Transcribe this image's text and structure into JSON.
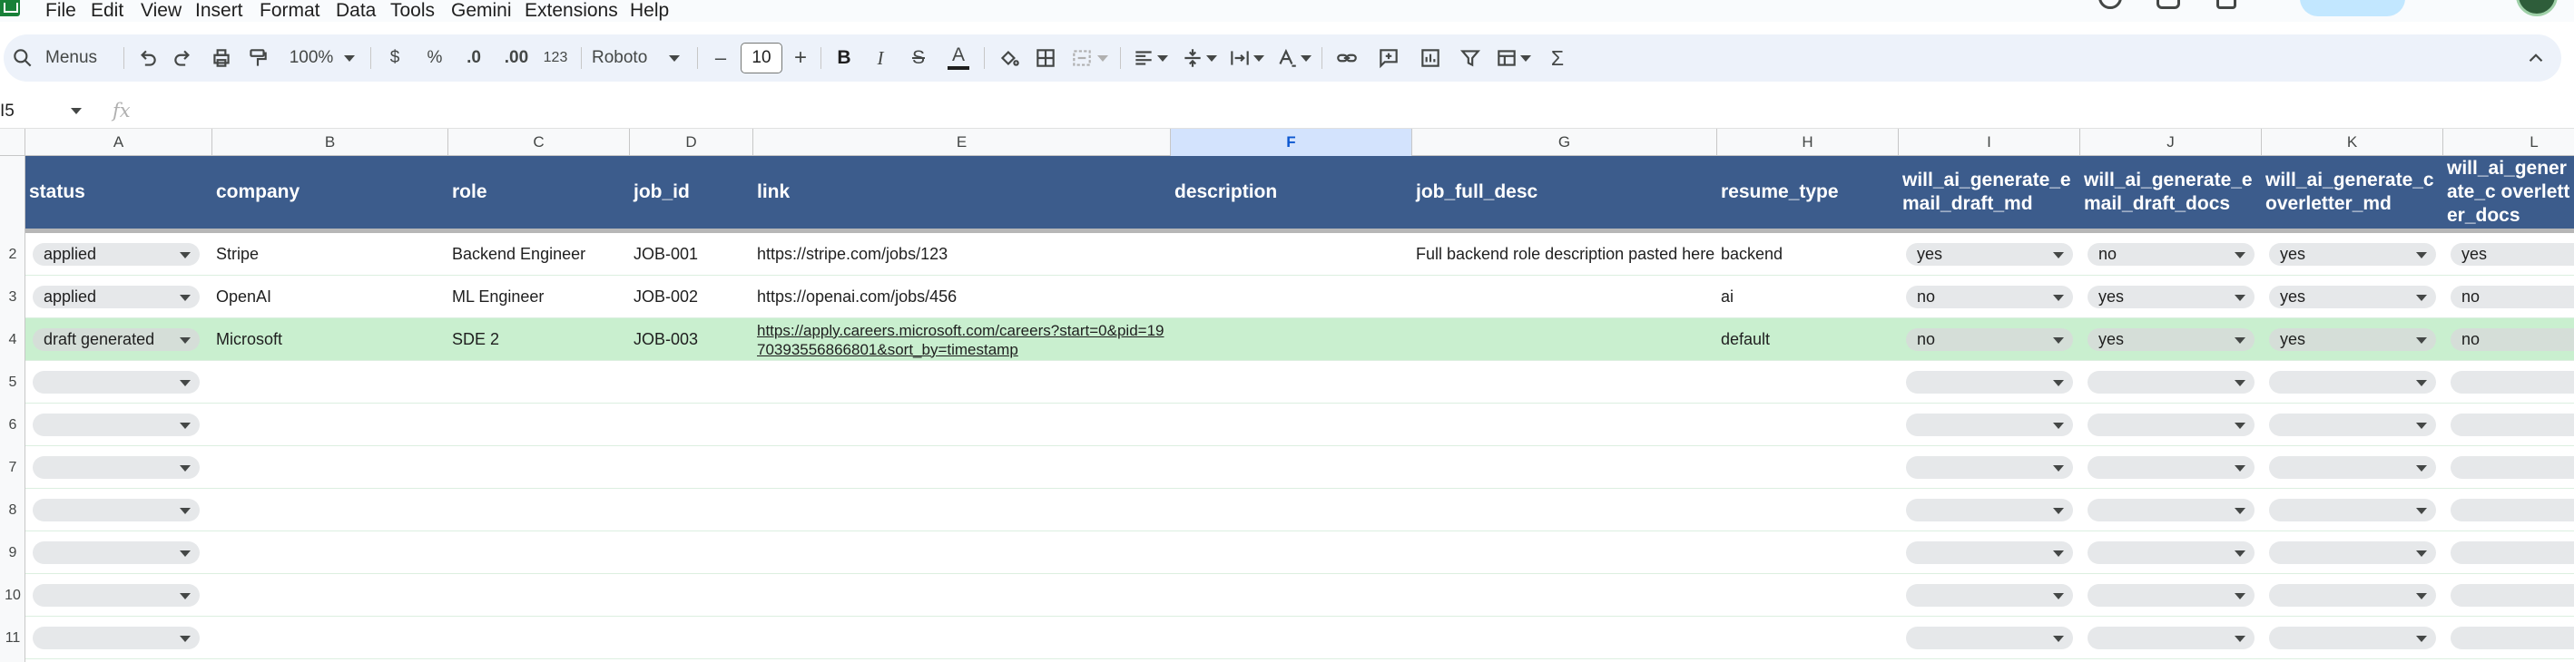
{
  "menu": [
    "File",
    "Edit",
    "View",
    "Insert",
    "Format",
    "Data",
    "Tools",
    "Gemini",
    "Extensions",
    "Help"
  ],
  "toolbar": {
    "menus_label": "Menus",
    "zoom": "100%",
    "currency": "$",
    "percent": "%",
    "decrease_decimal": ".0",
    "increase_decimal": ".00",
    "number_format": "123",
    "font": "Roboto",
    "font_size": "10",
    "minus": "–",
    "plus": "+",
    "bold": "B",
    "italic": "I",
    "strike": "S",
    "text_color": "A",
    "sum": "Σ"
  },
  "formula_bar": {
    "name_box": "I5",
    "fx": "fx"
  },
  "columns": [
    "A",
    "B",
    "C",
    "D",
    "E",
    "F",
    "G",
    "H",
    "I",
    "J",
    "K",
    "L"
  ],
  "selected_column": "F",
  "headers": [
    "status",
    "company",
    "role",
    "job_id",
    "link",
    "description",
    "job_full_desc",
    "resume_type",
    "will_ai_generate_e mail_draft_md",
    "will_ai_generate_e mail_draft_docs",
    "will_ai_generate_c overletter_md",
    "will_ai_generate_c overletter_docs"
  ],
  "row_numbers": [
    "2",
    "3",
    "4",
    "5",
    "6",
    "7",
    "8",
    "9",
    "10",
    "11"
  ],
  "rows": [
    {
      "status": "applied",
      "company": "Stripe",
      "role": "Backend Engineer",
      "job_id": "JOB-001",
      "link": "https://stripe.com/jobs/123",
      "description": "",
      "job_full_desc": "Full backend role description pasted here",
      "resume_type": "backend",
      "i": "yes",
      "j": "no",
      "k": "yes",
      "l": "yes"
    },
    {
      "status": "applied",
      "company": "OpenAI",
      "role": "ML Engineer",
      "job_id": "JOB-002",
      "link": "https://openai.com/jobs/456",
      "description": "",
      "job_full_desc": "",
      "resume_type": "ai",
      "i": "no",
      "j": "yes",
      "k": "yes",
      "l": "no"
    },
    {
      "status": "draft generated",
      "company": "Microsoft",
      "role": "SDE 2",
      "job_id": "JOB-003",
      "link": "https://apply.careers.microsoft.com/careers?start=0&pid=1970393556866801&sort_by=timestamp",
      "description": "",
      "job_full_desc": "",
      "resume_type": "default",
      "i": "no",
      "j": "yes",
      "k": "yes",
      "l": "no"
    }
  ],
  "colors": {
    "header_band": "#3c5c8c",
    "highlight_row": "#c9efcf",
    "chip": "#e6e8ea",
    "selected_col": "#d3e3fd"
  }
}
